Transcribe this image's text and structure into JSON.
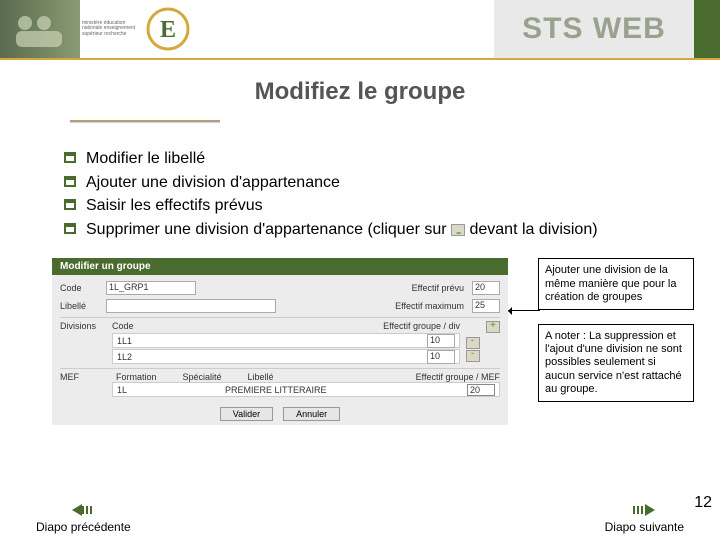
{
  "header": {
    "ministry": "ministère éducation nationale enseignement supérieur recherche",
    "brand": "STS WEB"
  },
  "title": "Modifiez le groupe",
  "bullets": {
    "b1": "Modifier le libellé",
    "b2": "Ajouter une division d'appartenance",
    "b3": "Saisir les effectifs prévus",
    "b4_a": "Supprimer une division d'appartenance (cliquer sur ",
    "b4_b": " devant la division)"
  },
  "form": {
    "heading": "Modifier un groupe",
    "code_label": "Code",
    "code_value": "1L_GRP1",
    "effectif_prevu_label": "Effectif prévu",
    "effectif_prevu_value": "20",
    "libelle_label": "Libellé",
    "libelle_value": "",
    "effectif_max_label": "Effectif maximum",
    "effectif_max_value": "25",
    "divisions_label": "Divisions",
    "div_code_label": "Code",
    "div_eff_label": "Effectif groupe / div",
    "rows": [
      {
        "code": "1L1",
        "eff": "10"
      },
      {
        "code": "1L2",
        "eff": "10"
      }
    ],
    "mef_label": "MEF",
    "mef_formation": "Formation",
    "mef_specialite": "Spécialité",
    "mef_libelle": "Libellé",
    "mef_eff_label": "Effectif groupe / MEF",
    "mef_row": {
      "formation": "1L",
      "specialite": "",
      "libelle": "PREMIERE LITTERAIRE",
      "eff": "20"
    },
    "valider": "Valider",
    "annuler": "Annuler"
  },
  "notes": {
    "n1": "Ajouter une division de la même manière que pour la création de groupes",
    "n2": "A noter : La suppression et l'ajout d'une division ne sont possibles seulement si aucun service n'est rattaché au groupe."
  },
  "footer": {
    "prev": "Diapo précédente",
    "next": "Diapo suivante",
    "page": "12"
  }
}
